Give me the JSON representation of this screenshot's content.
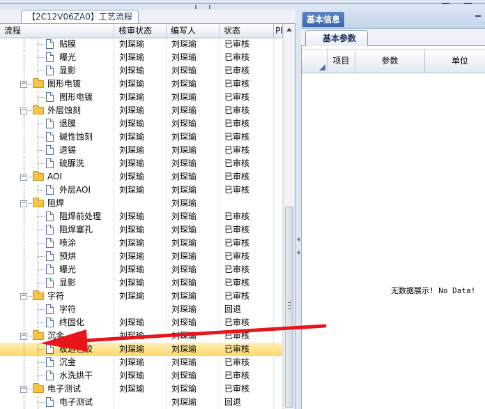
{
  "left_panel": {
    "tab_title": "【2C12V06ZA0】工艺流程",
    "columns": [
      "流程",
      "核审状态",
      "编写人",
      "状态",
      "Pl"
    ],
    "rows": [
      {
        "level": 2,
        "type": "doc",
        "name": "贴膜",
        "review": "刘琛瑜",
        "writer": "刘琛瑜",
        "status": "已审核"
      },
      {
        "level": 2,
        "type": "doc",
        "name": "曝光",
        "review": "刘琛瑜",
        "writer": "刘琛瑜",
        "status": "已审核"
      },
      {
        "level": 2,
        "type": "doc",
        "name": "显影",
        "review": "刘琛瑜",
        "writer": "刘琛瑜",
        "status": "已审核"
      },
      {
        "level": 1,
        "type": "folder",
        "name": "图形电镀",
        "review": "刘琛瑜",
        "writer": "刘琛瑜",
        "status": "已审核"
      },
      {
        "level": 2,
        "type": "doc",
        "name": "图形电镀",
        "review": "刘琛瑜",
        "writer": "刘琛瑜",
        "status": "已审核"
      },
      {
        "level": 1,
        "type": "folder",
        "name": "外层蚀刻",
        "review": "刘琛瑜",
        "writer": "刘琛瑜",
        "status": "已审核"
      },
      {
        "level": 2,
        "type": "doc",
        "name": "退膜",
        "review": "刘琛瑜",
        "writer": "刘琛瑜",
        "status": "已审核"
      },
      {
        "level": 2,
        "type": "doc",
        "name": "碱性蚀刻",
        "review": "刘琛瑜",
        "writer": "刘琛瑜",
        "status": "已审核"
      },
      {
        "level": 2,
        "type": "doc",
        "name": "退锡",
        "review": "刘琛瑜",
        "writer": "刘琛瑜",
        "status": "已审核"
      },
      {
        "level": 2,
        "type": "doc",
        "name": "硫脲洗",
        "review": "刘琛瑜",
        "writer": "刘琛瑜",
        "status": "已审核"
      },
      {
        "level": 1,
        "type": "folder",
        "name": "AOI",
        "review": "刘琛瑜",
        "writer": "刘琛瑜",
        "status": "已审核"
      },
      {
        "level": 2,
        "type": "doc",
        "name": "外层AOI",
        "review": "刘琛瑜",
        "writer": "刘琛瑜",
        "status": "已审核"
      },
      {
        "level": 1,
        "type": "folder",
        "name": "阻焊",
        "review": "",
        "writer": "刘琛瑜",
        "status": ""
      },
      {
        "level": 2,
        "type": "doc",
        "name": "阻焊前处理",
        "review": "刘琛瑜",
        "writer": "刘琛瑜",
        "status": "已审核"
      },
      {
        "level": 2,
        "type": "doc",
        "name": "阻焊塞孔",
        "review": "刘琛瑜",
        "writer": "刘琛瑜",
        "status": "已审核"
      },
      {
        "level": 2,
        "type": "doc",
        "name": "喷涂",
        "review": "刘琛瑜",
        "writer": "刘琛瑜",
        "status": "已审核"
      },
      {
        "level": 2,
        "type": "doc",
        "name": "预烘",
        "review": "刘琛瑜",
        "writer": "刘琛瑜",
        "status": "已审核"
      },
      {
        "level": 2,
        "type": "doc",
        "name": "曝光",
        "review": "刘琛瑜",
        "writer": "刘琛瑜",
        "status": "已审核"
      },
      {
        "level": 2,
        "type": "doc",
        "name": "显影",
        "review": "刘琛瑜",
        "writer": "刘琛瑜",
        "status": "已审核"
      },
      {
        "level": 1,
        "type": "folder",
        "name": "字符",
        "review": "刘琛瑜",
        "writer": "刘琛瑜",
        "status": "已审核"
      },
      {
        "level": 2,
        "type": "doc",
        "name": "字符",
        "review": "",
        "writer": "刘琛瑜",
        "status": "回退"
      },
      {
        "level": 2,
        "type": "doc",
        "name": "终固化",
        "review": "刘琛瑜",
        "writer": "刘琛瑜",
        "status": "已审核"
      },
      {
        "level": 1,
        "type": "folder",
        "name": "沉金",
        "review": "刘琛瑜",
        "writer": "刘琛瑜",
        "status": "已审核"
      },
      {
        "level": 2,
        "type": "doc",
        "name": "板边包胶",
        "review": "刘琛瑜",
        "writer": "刘琛瑜",
        "status": "已审核",
        "selected": true
      },
      {
        "level": 2,
        "type": "doc",
        "name": "沉金",
        "review": "刘琛瑜",
        "writer": "刘琛瑜",
        "status": "已审核"
      },
      {
        "level": 2,
        "type": "doc",
        "name": "水洗烘干",
        "review": "刘琛瑜",
        "writer": "刘琛瑜",
        "status": "已审核"
      },
      {
        "level": 1,
        "type": "folder",
        "name": "电子测试",
        "review": "刘琛瑜",
        "writer": "刘琛瑜",
        "status": "已审核"
      },
      {
        "level": 2,
        "type": "doc",
        "name": "电子测试",
        "review": "",
        "writer": "刘琛瑜",
        "status": "回退"
      }
    ]
  },
  "right_panel": {
    "title": "基本信息",
    "sub_tab": "基本参数",
    "columns": [
      "项目",
      "参数",
      "单位"
    ],
    "empty_text": "无数据展示! No Data!"
  },
  "colors": {
    "selection": "#ffd766",
    "annotation_arrow": "#e8141c",
    "accent_tab": "#3a66aa"
  }
}
